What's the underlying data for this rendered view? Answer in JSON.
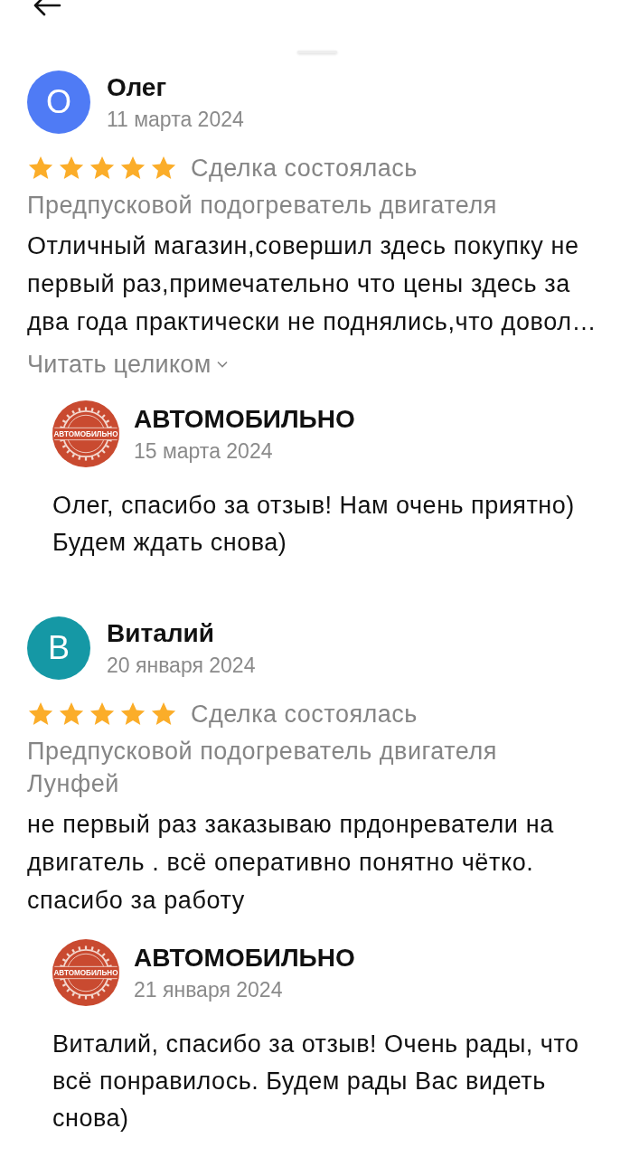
{
  "reviews": [
    {
      "author": "Олег",
      "avatar": {
        "letter": "О",
        "color": "#4f7bf5"
      },
      "date": "11 марта 2024",
      "stars": 5,
      "status": "Сделка состоялась",
      "product": "Предпусковой подогреватель двигателя",
      "text": "Отличный магазин,совершил здесь покупку не первый раз,примечательно что цены здесь за два года практически не поднялись,что довол…",
      "read_more": "Читать целиком",
      "reply": {
        "author": "АВТОМОБИЛЬНО",
        "logo_text": "АВТОМОБИЛЬНО",
        "date": "15 марта 2024",
        "text": "Олег, спасибо за отзыв! Нам очень приятно) Будем ждать снова)"
      }
    },
    {
      "author": "Виталий",
      "avatar": {
        "letter": "В",
        "color": "#1598a5"
      },
      "date": "20 января 2024",
      "stars": 5,
      "status": "Сделка состоялась",
      "product": "Предпусковой подогреватель двигателя Лунфей",
      "text": "не первый раз заказываю прдонреватели на двигатель . всё оперативно понятно чётко. спасибо за работу",
      "reply": {
        "author": "АВТОМОБИЛЬНО",
        "logo_text": "АВТОМОБИЛЬНО",
        "date": "21 января 2024",
        "text": "Виталий, спасибо за отзыв! Очень рады, что всё понравилось. Будем рады Вас видеть снова)"
      }
    }
  ]
}
